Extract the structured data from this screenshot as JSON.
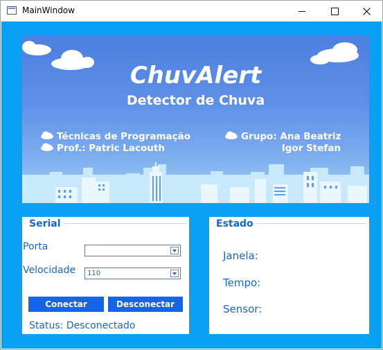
{
  "window": {
    "title": "MainWindow"
  },
  "banner": {
    "title": "ChuvAlert",
    "subtitle": "Detector de Chuva",
    "course": "Técnicas de Programação",
    "professor": "Prof.: Patric Lacouth",
    "group": "Grupo: Ana Beatriz",
    "member2": "Igor Stefan"
  },
  "serial": {
    "group_title": "Serial",
    "port_label": "Porta",
    "port_value": "",
    "speed_label": "Velocidade",
    "speed_value": "110",
    "connect_label": "Conectar",
    "disconnect_label": "Desconectar",
    "status": "Status: Desconectado"
  },
  "estado": {
    "group_title": "Estado",
    "window_label": "Janela:",
    "weather_label": "Tempo:",
    "sensor_label": "Sensor:"
  },
  "colors": {
    "background": "#0aa0f4",
    "accent": "#1565d8",
    "button": "#1565e6"
  },
  "icons": [
    "app-icon",
    "minimize-icon",
    "maximize-icon",
    "close-icon",
    "cloud-icon",
    "dropdown-arrow-icon"
  ]
}
